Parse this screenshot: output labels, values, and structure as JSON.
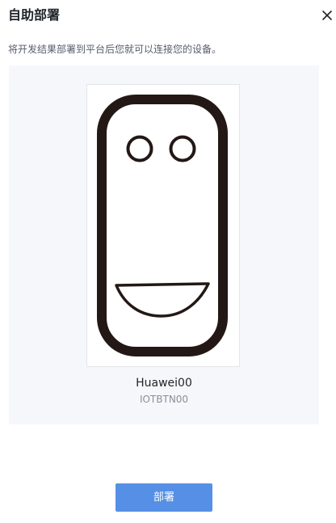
{
  "dialog": {
    "title": "自助部署",
    "description": "将开发结果部署到平台后您就可以连接您的设备。"
  },
  "device": {
    "name": "Huawei00",
    "model": "IOTBTN00",
    "image_icon": "device-face-illustration"
  },
  "actions": {
    "deploy_label": "部署"
  },
  "colors": {
    "accent": "#5690e6",
    "panel_bg": "#f6f7fb",
    "device_outline": "#231815"
  }
}
